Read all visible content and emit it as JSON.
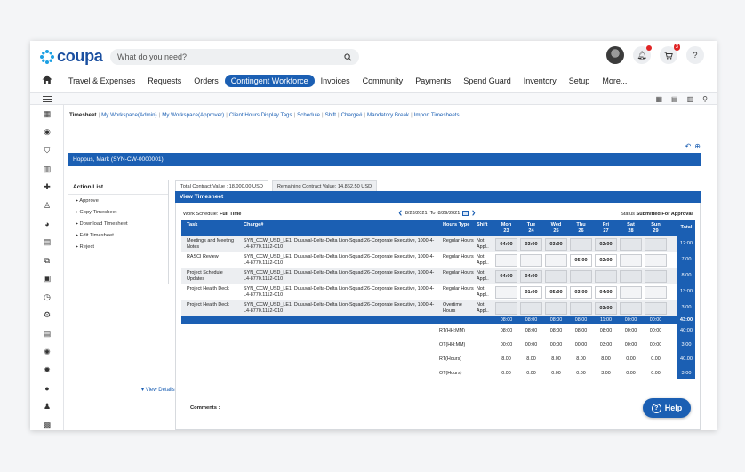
{
  "brand": {
    "logo_text": "coupa",
    "accent": "#1b5fb3"
  },
  "search": {
    "placeholder": "What do you need?"
  },
  "header": {
    "cart_count": "3",
    "help": "?"
  },
  "nav": {
    "items": [
      "Travel & Expenses",
      "Requests",
      "Orders",
      "Contingent Workforce",
      "Invoices",
      "Community",
      "Payments",
      "Spend Guard",
      "Inventory",
      "Setup",
      "More..."
    ],
    "active": "Contingent Workforce"
  },
  "breadcrumbs": [
    "Timesheet",
    "My Workspace(Admin)",
    "My Workspace(Approver)",
    "Client Hours Display Tags",
    "Schedule",
    "Shift",
    "Charge#",
    "Mandatory Break",
    "Import Timesheets"
  ],
  "person": "Hoppus, Mark (SYN-CW-0000001)",
  "action_list": {
    "title": "Action List",
    "items": [
      "Approve",
      "Copy Timesheet",
      "Download Timesheet",
      "Edit Timesheet",
      "Reject"
    ]
  },
  "contract": {
    "total": "Total Contract Value : 18,000.00 USD",
    "remaining": "Remaining Contract Value: 14,862.50 USD"
  },
  "timesheet": {
    "title": "View Timesheet",
    "work_schedule_label": "Work Schedule:",
    "work_schedule": "Full Time",
    "date_from": "8/23/2021",
    "to_label": "To",
    "date_to": "8/29/2021",
    "status_label": "Status",
    "status": "Submitted For Approval",
    "columns": {
      "task": "Task",
      "charge": "Charge#",
      "hours_type": "Hours Type",
      "shift": "Shift",
      "total": "Total"
    },
    "days": [
      {
        "name": "Mon",
        "num": "23"
      },
      {
        "name": "Tue",
        "num": "24"
      },
      {
        "name": "Wed",
        "num": "25"
      },
      {
        "name": "Thu",
        "num": "26"
      },
      {
        "name": "Fri",
        "num": "27"
      },
      {
        "name": "Sat",
        "num": "28"
      },
      {
        "name": "Sun",
        "num": "29"
      }
    ],
    "rows": [
      {
        "task": "Meetings and Meeting Notes",
        "charge": "SYN_CCW_USD_LE1, Duuuval-Delta-Delta Lion-Squad 26-Corporate Executive, 1000-4-L4-8770.1112-C10",
        "hours_type": "Regular Hours",
        "shift": "Not Appl..",
        "hours": [
          "04:00",
          "03:00",
          "03:00",
          "",
          "02:00",
          "",
          ""
        ],
        "total": "12:00"
      },
      {
        "task": "RASCI Review",
        "charge": "SYN_CCW_USD_LE1, Duuuval-Delta-Delta Lion-Squad 26-Corporate Executive, 1000-4-L4-8770.1112-C10",
        "hours_type": "Regular Hours",
        "shift": "Not Appl..",
        "hours": [
          "",
          "",
          "",
          "05:00",
          "02:00",
          "",
          ""
        ],
        "total": "7:00"
      },
      {
        "task": "Project Schedule Updates",
        "charge": "SYN_CCW_USD_LE1, Duuuval-Delta-Delta Lion-Squad 26-Corporate Executive, 1000-4-L4-8770.1112-C10",
        "hours_type": "Regular Hours",
        "shift": "Not Appl..",
        "hours": [
          "04:00",
          "04:00",
          "",
          "",
          "",
          "",
          ""
        ],
        "total": "8:00"
      },
      {
        "task": "Project Health Deck",
        "charge": "SYN_CCW_USD_LE1, Duuuval-Delta-Delta Lion-Squad 26-Corporate Executive, 1000-4-L4-8770.1112-C10",
        "hours_type": "Regular Hours",
        "shift": "Not Appl..",
        "hours": [
          "",
          "01:00",
          "05:00",
          "03:00",
          "04:00",
          "",
          ""
        ],
        "total": "13:00"
      },
      {
        "task": "Project Health Deck",
        "charge": "SYN_CCW_USD_LE1, Duuuval-Delta-Delta Lion-Squad 26-Corporate Executive, 1000-4-L4-8770.1112-C10",
        "hours_type": "Overtime Hours",
        "shift": "Not Appl..",
        "hours": [
          "",
          "",
          "",
          "",
          "03:00",
          "",
          ""
        ],
        "total": "3:00"
      }
    ],
    "daily_totals": [
      "08:00",
      "08:00",
      "08:00",
      "08:00",
      "11:00",
      "00:00",
      "00:00"
    ],
    "grand_total": "43:00",
    "summary": [
      {
        "label": "RT(HH:MM)",
        "values": [
          "08:00",
          "08:00",
          "08:00",
          "08:00",
          "08:00",
          "00:00",
          "00:00"
        ],
        "total": "40:00"
      },
      {
        "label": "OT(HH:MM)",
        "values": [
          "00:00",
          "00:00",
          "00:00",
          "00:00",
          "03:00",
          "00:00",
          "00:00"
        ],
        "total": "3:00"
      },
      {
        "label": "RT(Hours)",
        "values": [
          "8.00",
          "8.00",
          "8.00",
          "8.00",
          "8.00",
          "0.00",
          "0.00"
        ],
        "total": "40.00"
      },
      {
        "label": "OT(Hours)",
        "values": [
          "0.00",
          "0.00",
          "0.00",
          "0.00",
          "3.00",
          "0.00",
          "0.00"
        ],
        "total": "3.00"
      }
    ],
    "comments_label": "Comments :"
  },
  "view_details": "View Details",
  "help": "Help"
}
